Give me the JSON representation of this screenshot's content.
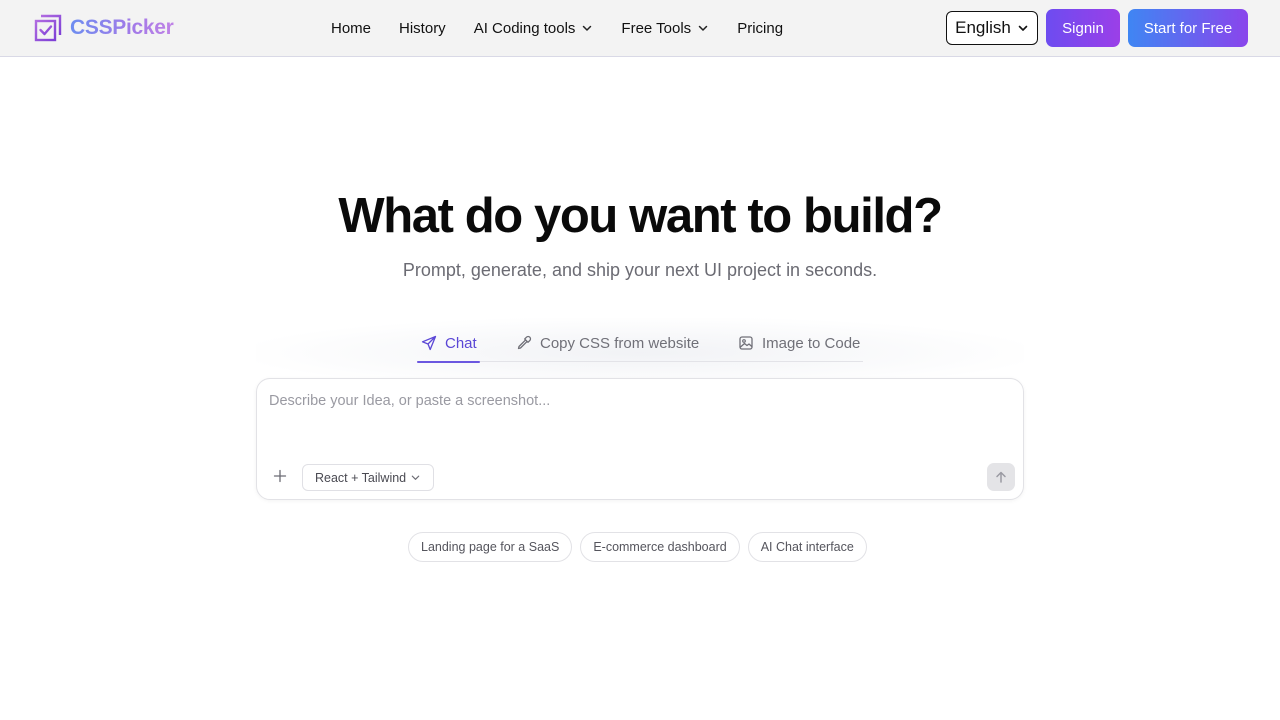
{
  "header": {
    "logo_text": "CSSPicker",
    "nav": [
      {
        "label": "Home",
        "dropdown": false
      },
      {
        "label": "History",
        "dropdown": false
      },
      {
        "label": "AI Coding tools",
        "dropdown": true
      },
      {
        "label": "Free Tools",
        "dropdown": true
      },
      {
        "label": "Pricing",
        "dropdown": false
      }
    ],
    "language": "English",
    "signin_label": "Signin",
    "start_label": "Start for Free"
  },
  "hero": {
    "title": "What do you want to build?",
    "subtitle": "Prompt, generate, and ship your next UI project in seconds."
  },
  "tabs": [
    {
      "label": "Chat",
      "icon": "send-icon",
      "active": true
    },
    {
      "label": "Copy CSS from website",
      "icon": "eyedropper-icon",
      "active": false
    },
    {
      "label": "Image to Code",
      "icon": "image-icon",
      "active": false
    }
  ],
  "prompt": {
    "placeholder": "Describe your Idea, or paste a screenshot...",
    "value": "",
    "framework": "React + Tailwind"
  },
  "suggestions": [
    "Landing page for a SaaS",
    "E-commerce dashboard",
    "AI Chat interface"
  ],
  "colors": {
    "accent": "#6b57e0",
    "signin_gradient_start": "#6d4cf0",
    "signin_gradient_end": "#9b3fe8",
    "start_gradient_start": "#3f86f3",
    "start_gradient_end": "#8a45ec",
    "header_bg": "#f3f3f3"
  }
}
